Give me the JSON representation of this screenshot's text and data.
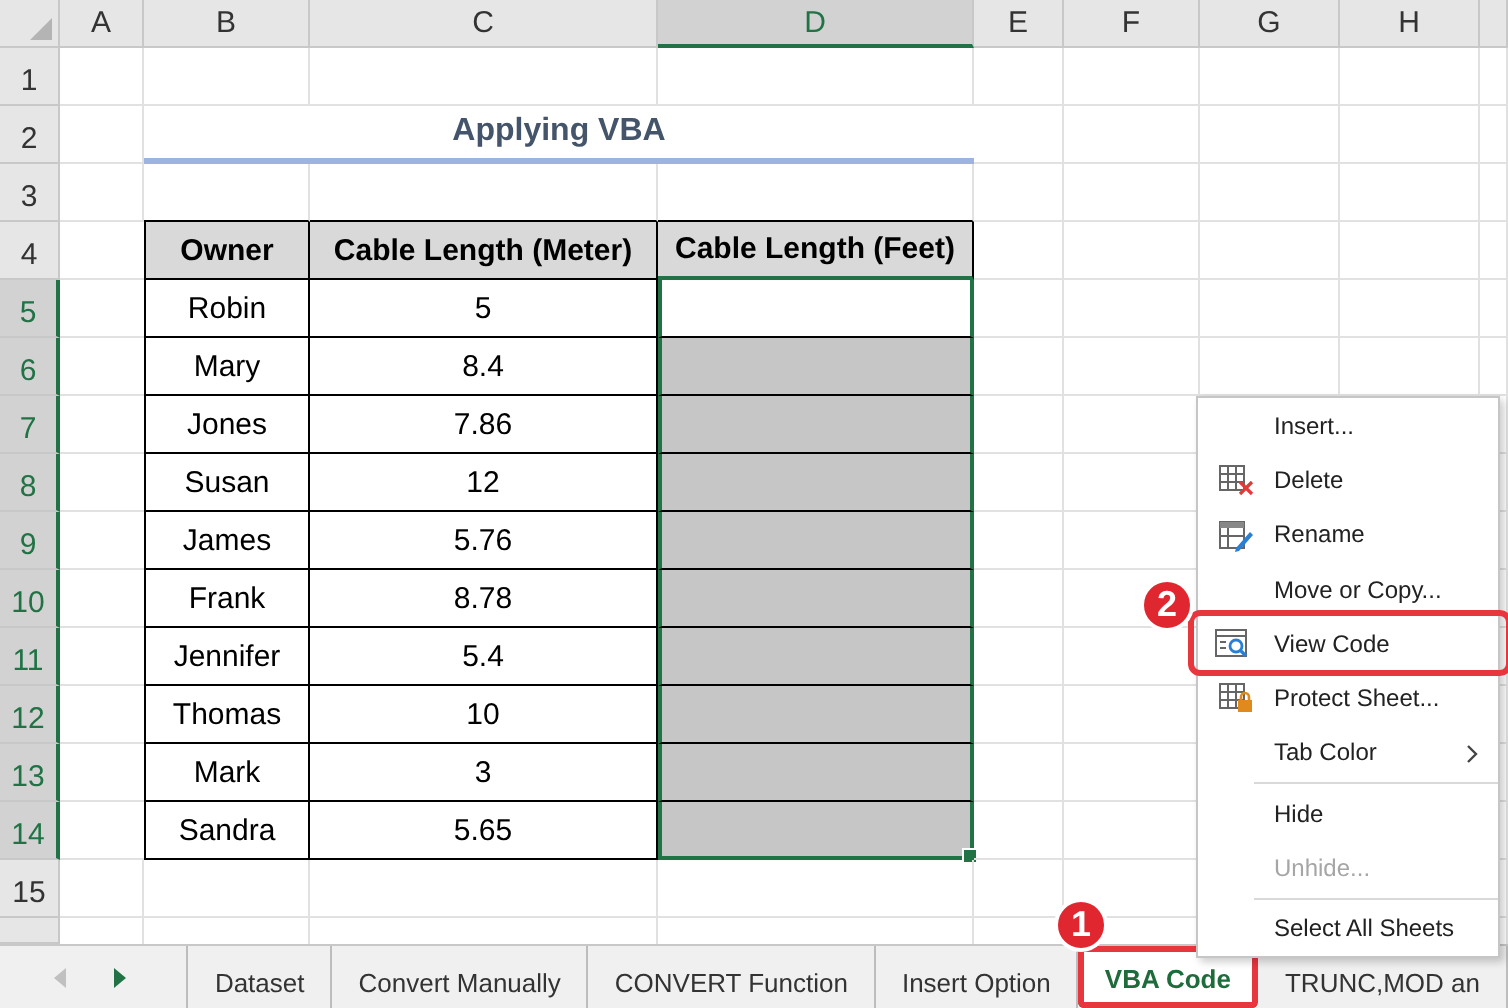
{
  "columns": [
    {
      "label": "A",
      "selected": false
    },
    {
      "label": "B",
      "selected": false
    },
    {
      "label": "C",
      "selected": false
    },
    {
      "label": "D",
      "selected": true
    },
    {
      "label": "E",
      "selected": false
    },
    {
      "label": "F",
      "selected": false
    },
    {
      "label": "G",
      "selected": false
    },
    {
      "label": "H",
      "selected": false
    }
  ],
  "row_headers": [
    {
      "label": "1",
      "selected": false
    },
    {
      "label": "2",
      "selected": false
    },
    {
      "label": "3",
      "selected": false
    },
    {
      "label": "4",
      "selected": false
    },
    {
      "label": "5",
      "selected": true
    },
    {
      "label": "6",
      "selected": true
    },
    {
      "label": "7",
      "selected": true
    },
    {
      "label": "8",
      "selected": true
    },
    {
      "label": "9",
      "selected": true
    },
    {
      "label": "10",
      "selected": true
    },
    {
      "label": "11",
      "selected": true
    },
    {
      "label": "12",
      "selected": true
    },
    {
      "label": "13",
      "selected": true
    },
    {
      "label": "14",
      "selected": true
    },
    {
      "label": "15",
      "selected": false
    }
  ],
  "title": "Applying VBA",
  "table": {
    "headers": [
      "Owner",
      "Cable Length (Meter)",
      "Cable Length (Feet)"
    ],
    "rows": [
      {
        "owner": "Robin",
        "meter": "5",
        "selected": true,
        "active": true
      },
      {
        "owner": "Mary",
        "meter": "8.4",
        "selected": true,
        "active": false
      },
      {
        "owner": "Jones",
        "meter": "7.86",
        "selected": true,
        "active": false
      },
      {
        "owner": "Susan",
        "meter": "12",
        "selected": true,
        "active": false
      },
      {
        "owner": "James",
        "meter": "5.76",
        "selected": true,
        "active": false
      },
      {
        "owner": "Frank",
        "meter": "8.78",
        "selected": true,
        "active": false
      },
      {
        "owner": "Jennifer",
        "meter": "5.4",
        "selected": true,
        "active": false
      },
      {
        "owner": "Thomas",
        "meter": "10",
        "selected": true,
        "active": false
      },
      {
        "owner": "Mark",
        "meter": "3",
        "selected": true,
        "active": false
      },
      {
        "owner": "Sandra",
        "meter": "5.65",
        "selected": true,
        "active": false
      }
    ]
  },
  "sheet_tabs": [
    {
      "label": "Dataset",
      "selected": false,
      "highlighted": false
    },
    {
      "label": "Convert Manually",
      "selected": false,
      "highlighted": false
    },
    {
      "label": "CONVERT Function",
      "selected": false,
      "highlighted": false
    },
    {
      "label": "Insert Option",
      "selected": false,
      "highlighted": false
    },
    {
      "label": "VBA Code",
      "selected": true,
      "highlighted": true
    },
    {
      "label": "TRUNC,MOD an",
      "selected": false,
      "highlighted": false
    }
  ],
  "context_menu": {
    "items": [
      {
        "kind": "item",
        "label": "Insert...",
        "highlighted": false,
        "disabled": false
      },
      {
        "kind": "delete",
        "label": "Delete",
        "highlighted": false,
        "disabled": false
      },
      {
        "kind": "rename",
        "label": "Rename",
        "highlighted": false,
        "disabled": false
      },
      {
        "kind": "item",
        "label": "Move or Copy...",
        "highlighted": false,
        "disabled": false
      },
      {
        "kind": "view",
        "label": "View Code",
        "highlighted": true,
        "disabled": false
      },
      {
        "kind": "protect",
        "label": "Protect Sheet...",
        "highlighted": false,
        "disabled": false
      },
      {
        "kind": "submenu",
        "label": "Tab Color",
        "highlighted": false,
        "disabled": false
      },
      {
        "kind": "separator"
      },
      {
        "kind": "item",
        "label": "Hide",
        "highlighted": false,
        "disabled": false
      },
      {
        "kind": "item",
        "label": "Unhide...",
        "highlighted": false,
        "disabled": true
      },
      {
        "kind": "separator"
      },
      {
        "kind": "item",
        "label": "Select All Sheets",
        "highlighted": false,
        "disabled": false
      }
    ]
  },
  "callouts": [
    {
      "label": "1"
    },
    {
      "label": "2"
    }
  ]
}
